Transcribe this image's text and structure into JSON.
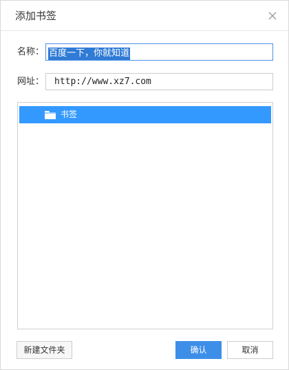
{
  "dialog": {
    "title": "添加书签",
    "close_icon": "close-icon"
  },
  "form": {
    "name_label": "名称：",
    "name_value": "百度一下，你就知道",
    "url_label": "网址：",
    "url_value": "http://www.xz7.com"
  },
  "folders": {
    "items": [
      {
        "label": "书签",
        "icon": "folder-icon",
        "selected": true
      }
    ]
  },
  "buttons": {
    "new_folder": "新建文件夹",
    "ok": "确认",
    "cancel": "取消"
  },
  "colors": {
    "accent": "#3399ff",
    "selection": "#2f7bd6",
    "primary_button": "#3d8ee8"
  }
}
